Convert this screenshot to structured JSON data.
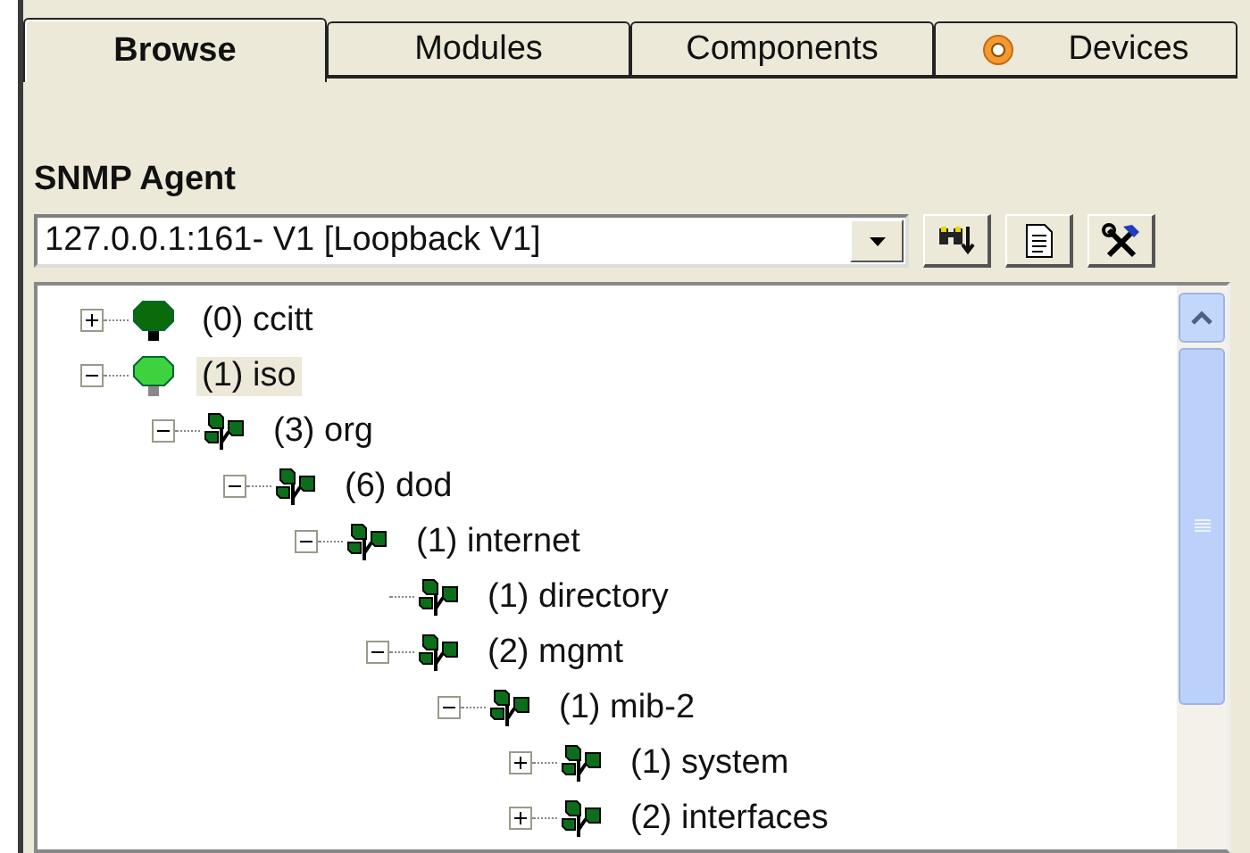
{
  "tabs": [
    {
      "label": "Browse",
      "selected": true,
      "icon": false
    },
    {
      "label": "Modules",
      "selected": false,
      "icon": false
    },
    {
      "label": "Components",
      "selected": false,
      "icon": false
    },
    {
      "label": "Devices",
      "selected": false,
      "icon": true
    }
  ],
  "agent": {
    "label": "SNMP Agent",
    "value": "127.0.0.1:161- V1 [Loopback V1]"
  },
  "tree": [
    {
      "label": "(0) ccitt",
      "kind": "root",
      "expanded": false,
      "selected": false
    },
    {
      "label": "(1) iso",
      "kind": "root",
      "expanded": true,
      "selected": true,
      "children": [
        {
          "label": "(3) org",
          "kind": "branch",
          "expanded": true,
          "selected": false,
          "children": [
            {
              "label": "(6) dod",
              "kind": "branch",
              "expanded": true,
              "selected": false,
              "children": [
                {
                  "label": "(1) internet",
                  "kind": "branch",
                  "expanded": true,
                  "selected": false,
                  "children": [
                    {
                      "label": "(1) directory",
                      "kind": "leaf",
                      "selected": false
                    },
                    {
                      "label": "(2) mgmt",
                      "kind": "branch",
                      "expanded": true,
                      "selected": false,
                      "children": [
                        {
                          "label": "(1) mib-2",
                          "kind": "branch",
                          "expanded": true,
                          "selected": false,
                          "children": [
                            {
                              "label": "(1) system",
                              "kind": "branch",
                              "expanded": false,
                              "selected": false
                            },
                            {
                              "label": "(2) interfaces",
                              "kind": "branch",
                              "expanded": false,
                              "selected": false
                            }
                          ]
                        }
                      ]
                    }
                  ]
                }
              ]
            }
          ]
        }
      ]
    }
  ]
}
